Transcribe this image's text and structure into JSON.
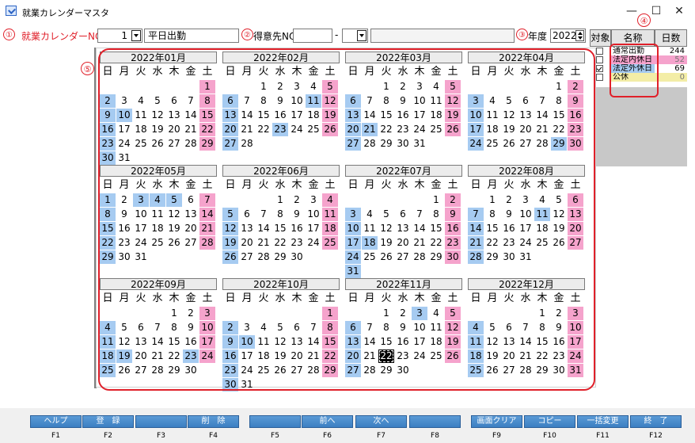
{
  "window": {
    "title": "就業カレンダーマスタ",
    "minimize": "—",
    "maximize": "☐",
    "close": "✕"
  },
  "header": {
    "marker1": "①",
    "calendar_no_label": "就業カレンダーNO",
    "calendar_no_value": "1",
    "calendar_name": "平日出勤",
    "marker2": "②",
    "customer_no_label": "得意先NO",
    "customer_no_value": "",
    "customer_sep": "-",
    "customer_sub_value": "",
    "marker3": "③",
    "year_label": "年度",
    "year_value": "2022"
  },
  "marker4": "④",
  "marker5": "⑤",
  "legend": {
    "headers": [
      "対象",
      "名称",
      "日数"
    ],
    "rows": [
      {
        "checked": false,
        "name": "通常出勤",
        "days": "244",
        "color": "#ffffff"
      },
      {
        "checked": false,
        "name": "法定内休日",
        "days": "52",
        "color": "#f5a3cc"
      },
      {
        "checked": true,
        "name": "法定外休日",
        "days": "69",
        "color": "#a6cbf1"
      },
      {
        "checked": false,
        "name": "公休",
        "days": "0",
        "color": "#f3eda6"
      }
    ]
  },
  "calendar": {
    "weekdays": [
      "日",
      "月",
      "火",
      "水",
      "木",
      "金",
      "土"
    ],
    "selected": {
      "month": 11,
      "day": 22
    },
    "months": [
      {
        "label": "2022年01月",
        "start": 6,
        "days": 31,
        "blue": [
          10
        ]
      },
      {
        "label": "2022年02月",
        "start": 2,
        "days": 28,
        "blue": [
          11,
          23
        ]
      },
      {
        "label": "2022年03月",
        "start": 2,
        "days": 31,
        "blue": [
          21
        ]
      },
      {
        "label": "2022年04月",
        "start": 5,
        "days": 30,
        "blue": [
          29
        ]
      },
      {
        "label": "2022年05月",
        "start": 0,
        "days": 31,
        "blue": [
          3,
          4,
          5
        ]
      },
      {
        "label": "2022年06月",
        "start": 3,
        "days": 30,
        "blue": []
      },
      {
        "label": "2022年07月",
        "start": 5,
        "days": 31,
        "blue": [
          18
        ]
      },
      {
        "label": "2022年08月",
        "start": 1,
        "days": 31,
        "blue": [
          11
        ]
      },
      {
        "label": "2022年09月",
        "start": 4,
        "days": 30,
        "blue": [
          19,
          23
        ]
      },
      {
        "label": "2022年10月",
        "start": 6,
        "days": 31,
        "blue": [
          10
        ]
      },
      {
        "label": "2022年11月",
        "start": 2,
        "days": 30,
        "blue": [
          3
        ]
      },
      {
        "label": "2022年12月",
        "start": 4,
        "days": 31,
        "blue": []
      }
    ]
  },
  "fkeys": [
    {
      "label": "ヘルプ",
      "key": "F1"
    },
    {
      "label": "登　録",
      "key": "F2"
    },
    {
      "label": "",
      "key": "F3"
    },
    {
      "label": "削　除",
      "key": "F4"
    },
    {
      "label": "",
      "key": "F5"
    },
    {
      "label": "前へ",
      "key": "F6"
    },
    {
      "label": "次へ",
      "key": "F7"
    },
    {
      "label": "",
      "key": "F8"
    },
    {
      "label": "画面クリア",
      "key": "F9"
    },
    {
      "label": "コピー",
      "key": "F10"
    },
    {
      "label": "一括変更",
      "key": "F11"
    },
    {
      "label": "終　了",
      "key": "F12"
    }
  ]
}
